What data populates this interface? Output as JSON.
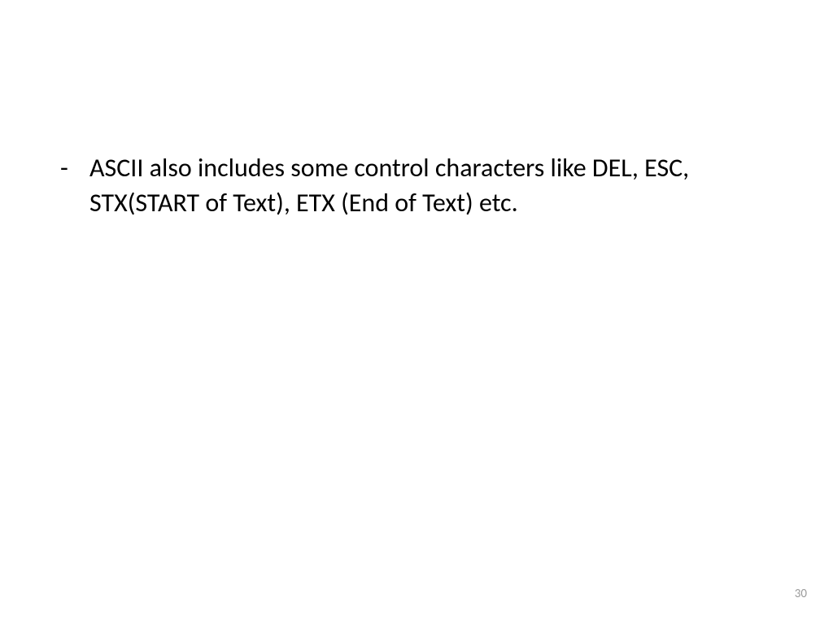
{
  "slide": {
    "bullet_marker": "-",
    "bullet_text": "ASCII also includes some control characters like DEL, ESC, STX(START of Text), ETX (End of Text) etc.",
    "page_number": "30"
  }
}
